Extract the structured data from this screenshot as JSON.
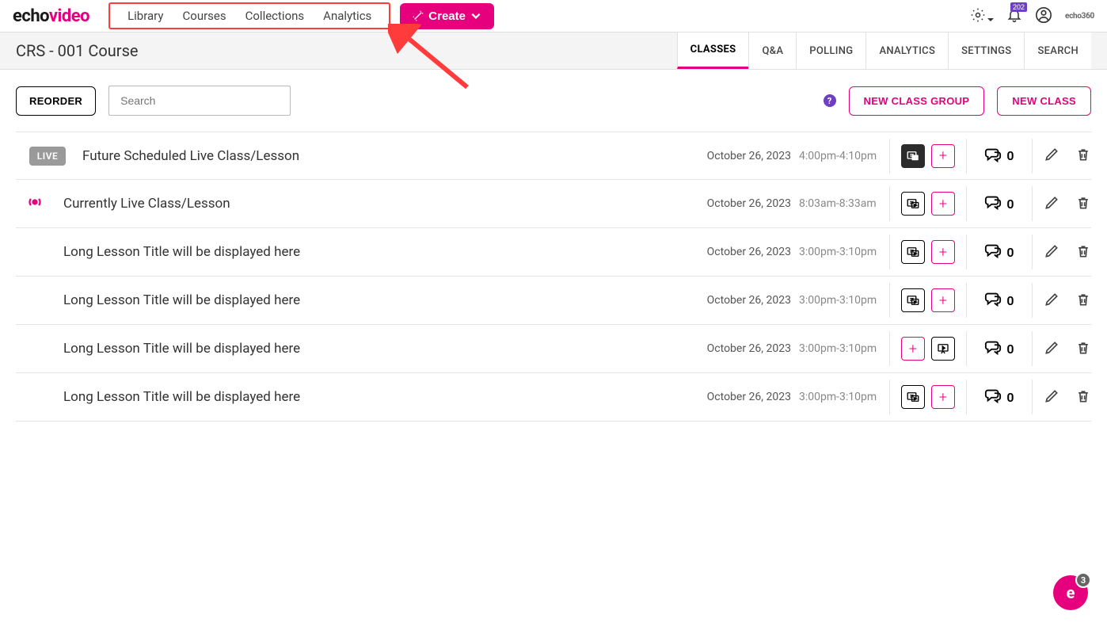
{
  "logo": {
    "part1": "echo",
    "part2": "video"
  },
  "nav": [
    "Library",
    "Courses",
    "Collections",
    "Analytics"
  ],
  "create_label": "Create",
  "notification_badge": "202",
  "echo360": "echo360",
  "course_title": "CRS - 001 Course",
  "tabs": [
    "CLASSES",
    "Q&A",
    "POLLING",
    "ANALYTICS",
    "SETTINGS",
    "SEARCH"
  ],
  "active_tab": 0,
  "toolbar": {
    "reorder": "REORDER",
    "search_placeholder": "Search",
    "new_group": "NEW CLASS GROUP",
    "new_class": "NEW CLASS"
  },
  "classes": [
    {
      "prefix_type": "live-badge",
      "prefix_text": "LIVE",
      "title": "Future Scheduled Live Class/Lesson",
      "date": "October 26, 2023",
      "time": "4:00pm-4:10pm",
      "btn1": "media-dark",
      "btn2": "plus",
      "comments": "0"
    },
    {
      "prefix_type": "live-icon",
      "prefix_text": "",
      "title": "Currently Live Class/Lesson",
      "date": "October 26, 2023",
      "time": "8:03am-8:33am",
      "btn1": "media-light",
      "btn2": "plus",
      "comments": "0"
    },
    {
      "prefix_type": "none",
      "prefix_text": "",
      "title": "Long Lesson Title will be displayed here",
      "date": "October 26, 2023",
      "time": "3:00pm-3:10pm",
      "btn1": "media-light",
      "btn2": "plus",
      "comments": "0"
    },
    {
      "prefix_type": "none",
      "prefix_text": "",
      "title": "Long Lesson Title will be displayed here",
      "date": "October 26, 2023",
      "time": "3:00pm-3:10pm",
      "btn1": "media-light",
      "btn2": "plus",
      "comments": "0"
    },
    {
      "prefix_type": "none",
      "prefix_text": "",
      "title": "Long Lesson Title will be displayed here",
      "date": "October 26, 2023",
      "time": "3:00pm-3:10pm",
      "btn1": "plus",
      "btn2": "present",
      "comments": "0"
    },
    {
      "prefix_type": "none",
      "prefix_text": "",
      "title": "Long Lesson Title will be displayed here",
      "date": "October 26, 2023",
      "time": "3:00pm-3:10pm",
      "btn1": "media-light",
      "btn2": "plus",
      "comments": "0"
    }
  ],
  "chat_badge": "3"
}
